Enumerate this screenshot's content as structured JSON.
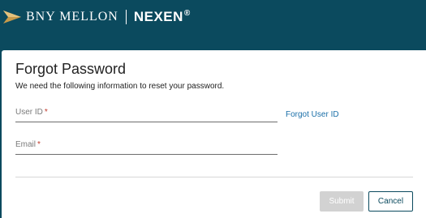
{
  "header": {
    "brand_left": "BNY MELLON",
    "brand_right": "NEXEN",
    "brand_mark": "®"
  },
  "form": {
    "title": "Forgot Password",
    "subtitle": "We need the following information to reset your password.",
    "user_id": {
      "label": "User ID",
      "required_mark": "*",
      "value": ""
    },
    "email": {
      "label": "Email",
      "required_mark": "*",
      "value": ""
    },
    "forgot_user_id_link": "Forgot User ID"
  },
  "actions": {
    "submit_label": "Submit",
    "cancel_label": "Cancel"
  },
  "colors": {
    "header_bg": "#0b4a5e",
    "link": "#1a6fa8",
    "required": "#c0392b",
    "submit_disabled_bg": "#d2d2d2",
    "logo_arrow": "#c79a4a"
  }
}
